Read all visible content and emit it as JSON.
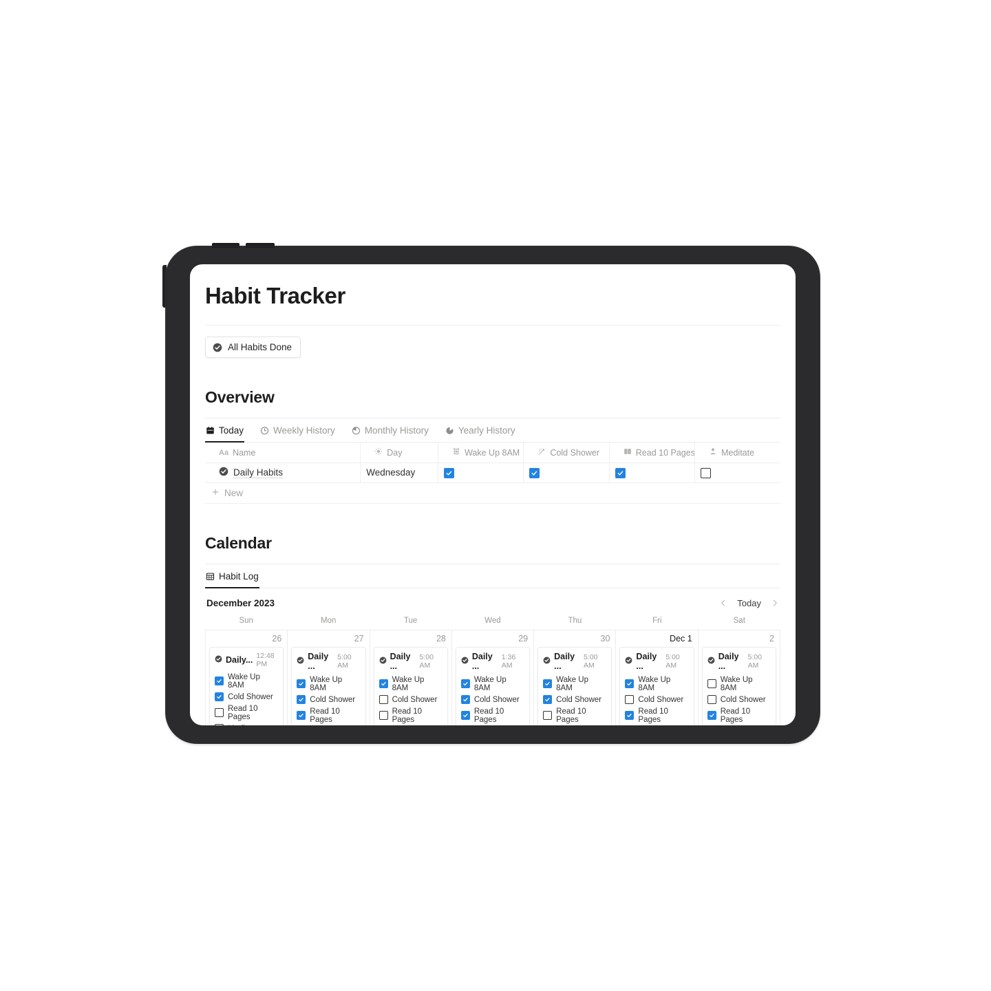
{
  "page": {
    "title": "Habit Tracker",
    "done_chip_label": "All Habits Done"
  },
  "overview": {
    "heading": "Overview",
    "tabs": [
      {
        "label": "Today",
        "icon": "calendar-icon",
        "active": true
      },
      {
        "label": "Weekly History",
        "icon": "clock-empty-icon",
        "active": false
      },
      {
        "label": "Monthly History",
        "icon": "clock-quarter-icon",
        "active": false
      },
      {
        "label": "Yearly History",
        "icon": "clock-three-quarter-icon",
        "active": false
      }
    ],
    "table": {
      "columns": [
        {
          "label": "Name",
          "icon": "aa-text-icon"
        },
        {
          "label": "Day",
          "icon": "sun-icon"
        },
        {
          "label": "Wake Up 8AM",
          "icon": "alarm-clock-icon"
        },
        {
          "label": "Cold Shower",
          "icon": "shower-icon"
        },
        {
          "label": "Read 10 Pages",
          "icon": "open-book-icon"
        },
        {
          "label": "Meditate",
          "icon": "person-icon"
        }
      ],
      "rows": [
        {
          "name": "Daily Habits",
          "day": "Wednesday",
          "wake_up_8am": true,
          "cold_shower": true,
          "read_10_pages": true,
          "meditate": false
        }
      ],
      "new_row_label": "New"
    }
  },
  "calendar": {
    "heading": "Calendar",
    "tabs": [
      {
        "label": "Habit Log",
        "icon": "calendar-grid-icon",
        "active": true
      }
    ],
    "month_label": "December 2023",
    "today_label": "Today",
    "prev_icon": "chevron-left-icon",
    "next_icon": "chevron-right-icon",
    "weekdays": [
      "Sun",
      "Mon",
      "Tue",
      "Wed",
      "Thu",
      "Fri",
      "Sat"
    ],
    "habit_labels": [
      "Wake Up 8AM",
      "Cold Shower",
      "Read 10 Pages",
      "Meditate"
    ],
    "days": [
      {
        "num": "26",
        "emphasis": false,
        "entry": {
          "title": "Daily...",
          "time": "12:48 PM",
          "checks": [
            true,
            true,
            false,
            false
          ]
        }
      },
      {
        "num": "27",
        "emphasis": false,
        "entry": {
          "title": "Daily ...",
          "time": "5:00 AM",
          "checks": [
            true,
            true,
            true,
            true
          ]
        }
      },
      {
        "num": "28",
        "emphasis": false,
        "entry": {
          "title": "Daily ...",
          "time": "5:00 AM",
          "checks": [
            true,
            false,
            false,
            true
          ]
        }
      },
      {
        "num": "29",
        "emphasis": false,
        "entry": {
          "title": "Daily ...",
          "time": "1:36 AM",
          "checks": [
            true,
            true,
            true,
            false
          ]
        }
      },
      {
        "num": "30",
        "emphasis": false,
        "entry": {
          "title": "Daily ...",
          "time": "5:00 AM",
          "checks": [
            true,
            true,
            false,
            false
          ]
        }
      },
      {
        "num": "Dec 1",
        "emphasis": true,
        "entry": {
          "title": "Daily ...",
          "time": "5:00 AM",
          "checks": [
            true,
            false,
            true,
            true
          ]
        }
      },
      {
        "num": "2",
        "emphasis": false,
        "entry": {
          "title": "Daily ...",
          "time": "5:00 AM",
          "checks": [
            false,
            false,
            true,
            false
          ]
        }
      }
    ]
  },
  "colors": {
    "checkbox_blue": "#2383e2",
    "text_primary": "#1d1d1d",
    "text_muted": "#9a9a97",
    "frame": "#2b2b2d"
  }
}
